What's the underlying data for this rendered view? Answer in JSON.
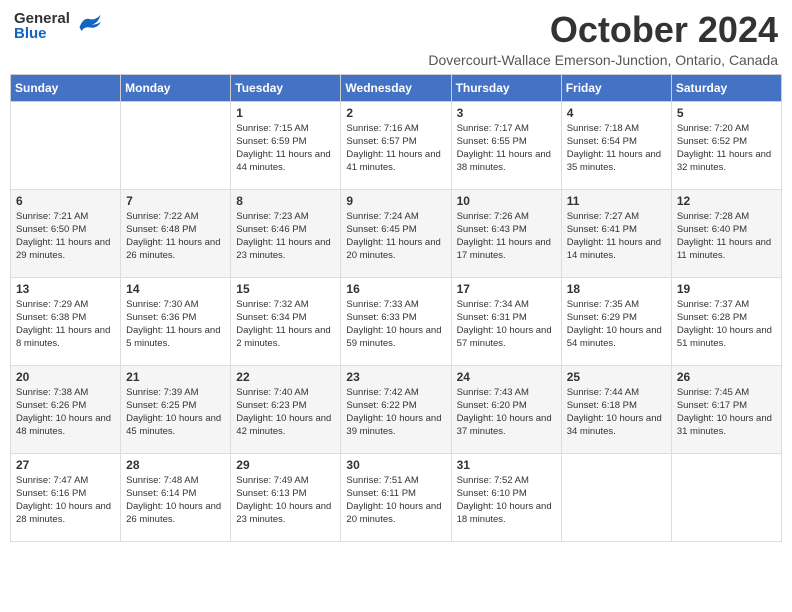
{
  "header": {
    "logo_general": "General",
    "logo_blue": "Blue",
    "month_title": "October 2024",
    "location": "Dovercourt-Wallace Emerson-Junction, Ontario, Canada"
  },
  "days_of_week": [
    "Sunday",
    "Monday",
    "Tuesday",
    "Wednesday",
    "Thursday",
    "Friday",
    "Saturday"
  ],
  "weeks": [
    {
      "cells": [
        {
          "day": null,
          "info": null
        },
        {
          "day": null,
          "info": null
        },
        {
          "day": "1",
          "info": "Sunrise: 7:15 AM\nSunset: 6:59 PM\nDaylight: 11 hours and 44 minutes."
        },
        {
          "day": "2",
          "info": "Sunrise: 7:16 AM\nSunset: 6:57 PM\nDaylight: 11 hours and 41 minutes."
        },
        {
          "day": "3",
          "info": "Sunrise: 7:17 AM\nSunset: 6:55 PM\nDaylight: 11 hours and 38 minutes."
        },
        {
          "day": "4",
          "info": "Sunrise: 7:18 AM\nSunset: 6:54 PM\nDaylight: 11 hours and 35 minutes."
        },
        {
          "day": "5",
          "info": "Sunrise: 7:20 AM\nSunset: 6:52 PM\nDaylight: 11 hours and 32 minutes."
        }
      ]
    },
    {
      "cells": [
        {
          "day": "6",
          "info": "Sunrise: 7:21 AM\nSunset: 6:50 PM\nDaylight: 11 hours and 29 minutes."
        },
        {
          "day": "7",
          "info": "Sunrise: 7:22 AM\nSunset: 6:48 PM\nDaylight: 11 hours and 26 minutes."
        },
        {
          "day": "8",
          "info": "Sunrise: 7:23 AM\nSunset: 6:46 PM\nDaylight: 11 hours and 23 minutes."
        },
        {
          "day": "9",
          "info": "Sunrise: 7:24 AM\nSunset: 6:45 PM\nDaylight: 11 hours and 20 minutes."
        },
        {
          "day": "10",
          "info": "Sunrise: 7:26 AM\nSunset: 6:43 PM\nDaylight: 11 hours and 17 minutes."
        },
        {
          "day": "11",
          "info": "Sunrise: 7:27 AM\nSunset: 6:41 PM\nDaylight: 11 hours and 14 minutes."
        },
        {
          "day": "12",
          "info": "Sunrise: 7:28 AM\nSunset: 6:40 PM\nDaylight: 11 hours and 11 minutes."
        }
      ]
    },
    {
      "cells": [
        {
          "day": "13",
          "info": "Sunrise: 7:29 AM\nSunset: 6:38 PM\nDaylight: 11 hours and 8 minutes."
        },
        {
          "day": "14",
          "info": "Sunrise: 7:30 AM\nSunset: 6:36 PM\nDaylight: 11 hours and 5 minutes."
        },
        {
          "day": "15",
          "info": "Sunrise: 7:32 AM\nSunset: 6:34 PM\nDaylight: 11 hours and 2 minutes."
        },
        {
          "day": "16",
          "info": "Sunrise: 7:33 AM\nSunset: 6:33 PM\nDaylight: 10 hours and 59 minutes."
        },
        {
          "day": "17",
          "info": "Sunrise: 7:34 AM\nSunset: 6:31 PM\nDaylight: 10 hours and 57 minutes."
        },
        {
          "day": "18",
          "info": "Sunrise: 7:35 AM\nSunset: 6:29 PM\nDaylight: 10 hours and 54 minutes."
        },
        {
          "day": "19",
          "info": "Sunrise: 7:37 AM\nSunset: 6:28 PM\nDaylight: 10 hours and 51 minutes."
        }
      ]
    },
    {
      "cells": [
        {
          "day": "20",
          "info": "Sunrise: 7:38 AM\nSunset: 6:26 PM\nDaylight: 10 hours and 48 minutes."
        },
        {
          "day": "21",
          "info": "Sunrise: 7:39 AM\nSunset: 6:25 PM\nDaylight: 10 hours and 45 minutes."
        },
        {
          "day": "22",
          "info": "Sunrise: 7:40 AM\nSunset: 6:23 PM\nDaylight: 10 hours and 42 minutes."
        },
        {
          "day": "23",
          "info": "Sunrise: 7:42 AM\nSunset: 6:22 PM\nDaylight: 10 hours and 39 minutes."
        },
        {
          "day": "24",
          "info": "Sunrise: 7:43 AM\nSunset: 6:20 PM\nDaylight: 10 hours and 37 minutes."
        },
        {
          "day": "25",
          "info": "Sunrise: 7:44 AM\nSunset: 6:18 PM\nDaylight: 10 hours and 34 minutes."
        },
        {
          "day": "26",
          "info": "Sunrise: 7:45 AM\nSunset: 6:17 PM\nDaylight: 10 hours and 31 minutes."
        }
      ]
    },
    {
      "cells": [
        {
          "day": "27",
          "info": "Sunrise: 7:47 AM\nSunset: 6:16 PM\nDaylight: 10 hours and 28 minutes."
        },
        {
          "day": "28",
          "info": "Sunrise: 7:48 AM\nSunset: 6:14 PM\nDaylight: 10 hours and 26 minutes."
        },
        {
          "day": "29",
          "info": "Sunrise: 7:49 AM\nSunset: 6:13 PM\nDaylight: 10 hours and 23 minutes."
        },
        {
          "day": "30",
          "info": "Sunrise: 7:51 AM\nSunset: 6:11 PM\nDaylight: 10 hours and 20 minutes."
        },
        {
          "day": "31",
          "info": "Sunrise: 7:52 AM\nSunset: 6:10 PM\nDaylight: 10 hours and 18 minutes."
        },
        {
          "day": null,
          "info": null
        },
        {
          "day": null,
          "info": null
        }
      ]
    }
  ]
}
